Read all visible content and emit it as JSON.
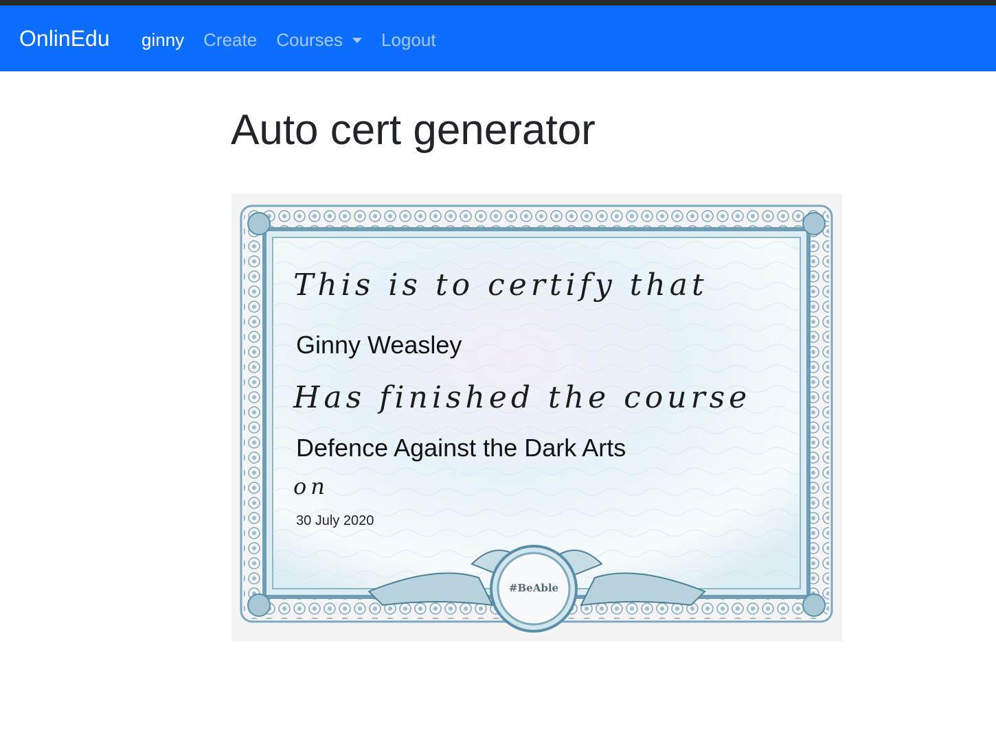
{
  "navbar": {
    "brand": "OnlinEdu",
    "items": [
      {
        "label": "ginny",
        "active": true
      },
      {
        "label": "Create",
        "active": false
      },
      {
        "label": "Courses",
        "active": false,
        "dropdown": true
      },
      {
        "label": "Logout",
        "active": false
      }
    ]
  },
  "page": {
    "title": "Auto cert generator"
  },
  "certificate": {
    "line_intro": "This is to certify that",
    "recipient": "Ginny Weasley",
    "line_course": "Has finished the course",
    "course": "Defence Against the Dark Arts",
    "line_on": "on",
    "date": "30 July 2020",
    "seal_text": "#BeAble"
  },
  "colors": {
    "navbar": "#0d6efd",
    "cert_border": "#5b8fa8",
    "cert_fill": "#e3f2f7"
  }
}
